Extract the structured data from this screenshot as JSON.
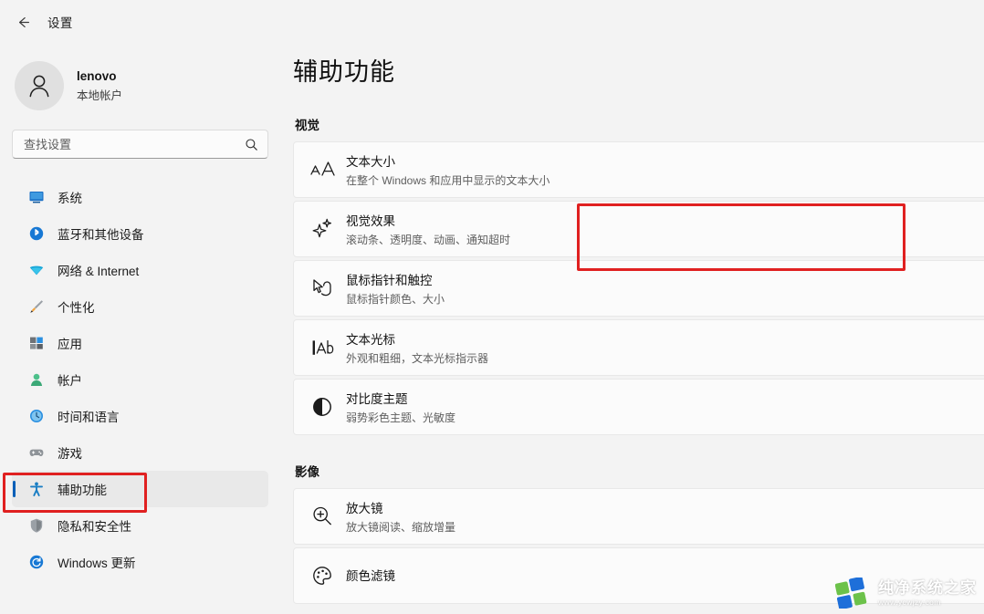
{
  "window": {
    "title": "设置",
    "back_icon": "back-arrow-icon"
  },
  "account": {
    "name": "lenovo",
    "type": "本地帐户",
    "avatar_icon": "person-avatar-icon"
  },
  "search": {
    "placeholder": "查找设置",
    "value": "",
    "icon": "search-icon"
  },
  "sidebar": {
    "items": [
      {
        "label": "系统",
        "icon": "monitor-icon",
        "selected": false
      },
      {
        "label": "蓝牙和其他设备",
        "icon": "bluetooth-icon",
        "selected": false
      },
      {
        "label": "网络 & Internet",
        "icon": "wifi-icon",
        "selected": false
      },
      {
        "label": "个性化",
        "icon": "paintbrush-icon",
        "selected": false
      },
      {
        "label": "应用",
        "icon": "apps-icon",
        "selected": false
      },
      {
        "label": "帐户",
        "icon": "account-icon",
        "selected": false
      },
      {
        "label": "时间和语言",
        "icon": "clock-globe-icon",
        "selected": false
      },
      {
        "label": "游戏",
        "icon": "gamepad-icon",
        "selected": false
      },
      {
        "label": "辅助功能",
        "icon": "accessibility-icon",
        "selected": true
      },
      {
        "label": "隐私和安全性",
        "icon": "shield-icon",
        "selected": false
      },
      {
        "label": "Windows 更新",
        "icon": "update-icon",
        "selected": false
      }
    ]
  },
  "main": {
    "page_title": "辅助功能",
    "sections": [
      {
        "heading": "视觉",
        "cards": [
          {
            "title": "文本大小",
            "subtitle": "在整个 Windows 和应用中显示的文本大小",
            "icon": "text-size-aa-icon",
            "highlighted": false
          },
          {
            "title": "视觉效果",
            "subtitle": "滚动条、透明度、动画、通知超时",
            "icon": "sparkle-effects-icon",
            "highlighted": true
          },
          {
            "title": "鼠标指针和触控",
            "subtitle": "鼠标指针颜色、大小",
            "icon": "mouse-pointer-icon",
            "highlighted": false
          },
          {
            "title": "文本光标",
            "subtitle": "外观和粗细，文本光标指示器",
            "icon": "text-cursor-ab-icon",
            "highlighted": false
          },
          {
            "title": "对比度主题",
            "subtitle": "弱势彩色主题、光敏度",
            "icon": "contrast-circle-icon",
            "highlighted": false
          }
        ]
      },
      {
        "heading": "影像",
        "cards": [
          {
            "title": "放大镜",
            "subtitle": "放大镜阅读、缩放增量",
            "icon": "magnifier-plus-icon",
            "highlighted": false
          },
          {
            "title": "颜色滤镜",
            "subtitle": "",
            "icon": "color-filter-icon",
            "highlighted": false
          }
        ]
      }
    ]
  },
  "annotations": {
    "accent_color": "#e02020",
    "selection_accent": "#005fb8",
    "nav_highlight_target": "辅助功能",
    "card_highlight_target": "视觉效果"
  },
  "watermark": {
    "name": "纯净系统之家",
    "url": "www.ycwjzy.com"
  }
}
